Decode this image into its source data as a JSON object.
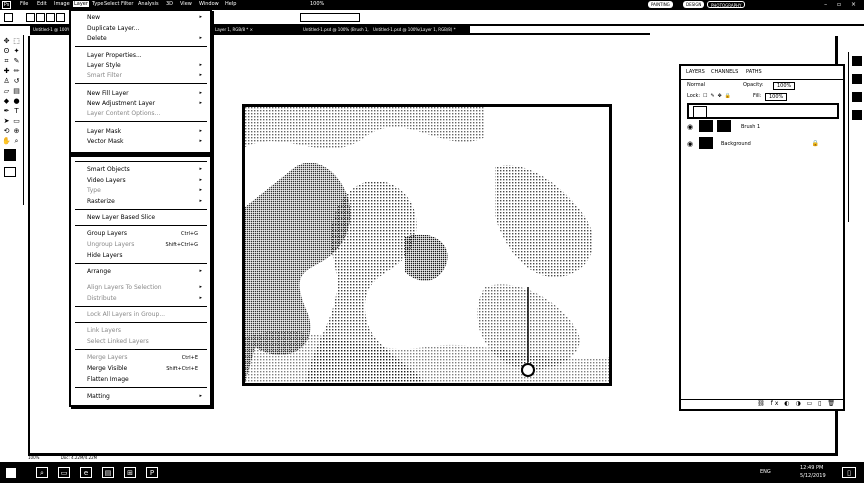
{
  "menubar": {
    "app_icon": "Ps",
    "items": [
      "File",
      "Edit",
      "Image",
      "Layer",
      "Type",
      "Select",
      "Filter",
      "Analysis",
      "3D",
      "View",
      "Window",
      "Help"
    ],
    "active_item": "Layer",
    "zoom": "100%",
    "workspace_buttons": [
      "PAINTING",
      "DESIGN",
      "PHOTOGRAPHY"
    ],
    "window_controls": "– ▫ ×"
  },
  "dropdown": {
    "items": [
      {
        "label": "New",
        "arrow": true
      },
      {
        "label": "Duplicate Layer..."
      },
      {
        "label": "Delete",
        "arrow": true
      },
      {
        "label": "Layer Properties..."
      },
      {
        "label": "Layer Style",
        "arrow": true
      },
      {
        "label": "Smart Filter",
        "dim": true,
        "arrow": true
      },
      {
        "label": "New Fill Layer",
        "arrow": true
      },
      {
        "label": "New Adjustment Layer",
        "arrow": true
      },
      {
        "label": "Layer Content Options...",
        "dim": true
      },
      {
        "label": "Layer Mask",
        "arrow": true
      },
      {
        "label": "Vector Mask",
        "arrow": true
      },
      {
        "label": "Smart Objects",
        "arrow": true
      },
      {
        "label": "Video Layers",
        "arrow": true
      },
      {
        "label": "Type",
        "dim": true,
        "arrow": true
      },
      {
        "label": "Rasterize",
        "arrow": true
      },
      {
        "label": "New Layer Based Slice"
      },
      {
        "label": "Group Layers",
        "shortcut": "Ctrl+G"
      },
      {
        "label": "Ungroup Layers",
        "dim": true,
        "shortcut": "Shift+Ctrl+G"
      },
      {
        "label": "Hide Layers"
      },
      {
        "label": "Arrange",
        "arrow": true
      },
      {
        "label": "Align Layers To Selection",
        "dim": true,
        "arrow": true
      },
      {
        "label": "Distribute",
        "dim": true,
        "arrow": true
      },
      {
        "label": "Lock All Layers in Group...",
        "dim": true
      },
      {
        "label": "Link Layers",
        "dim": true
      },
      {
        "label": "Select Linked Layers",
        "dim": true
      },
      {
        "label": "Merge Layers",
        "dim": true,
        "shortcut": "Ctrl+E"
      },
      {
        "label": "Merge Visible",
        "shortcut": "Shift+Ctrl+E"
      },
      {
        "label": "Flatten Image"
      },
      {
        "label": "Matting",
        "arrow": true
      }
    ]
  },
  "panel": {
    "tabs": [
      "LAYERS",
      "CHANNELS",
      "PATHS"
    ],
    "blend_mode": "Normal",
    "opacity_label": "Opacity:",
    "opacity_value": "100%",
    "lock_label": "Lock:",
    "fill_label": "Fill:",
    "fill_value": "100%",
    "layers": [
      {
        "name": "",
        "type": "selected"
      },
      {
        "name": "Brush 1",
        "type": "adjustment"
      },
      {
        "name": "Background",
        "type": "background"
      }
    ],
    "bottom_icons": "⛓ fx ◐ ◑ ▭ ▯ 🗑"
  },
  "statusbar": {
    "zoom": "100%",
    "doc": "Doc: 4.22M/4.22M"
  },
  "tabs": [
    "Untitled-1 @ 100% (Layer 1, RGB/8)",
    "Layer 1, RGB/8 * ×",
    "Untitled-1.psd @ 100% (Brush 1, RGB/8) *",
    "Untitled-1.psd @ 100%(Layer 1, RGB/8) *"
  ],
  "taskbar": {
    "time": "12:49 PM",
    "date": "5/12/2019",
    "lang": "ENG"
  }
}
